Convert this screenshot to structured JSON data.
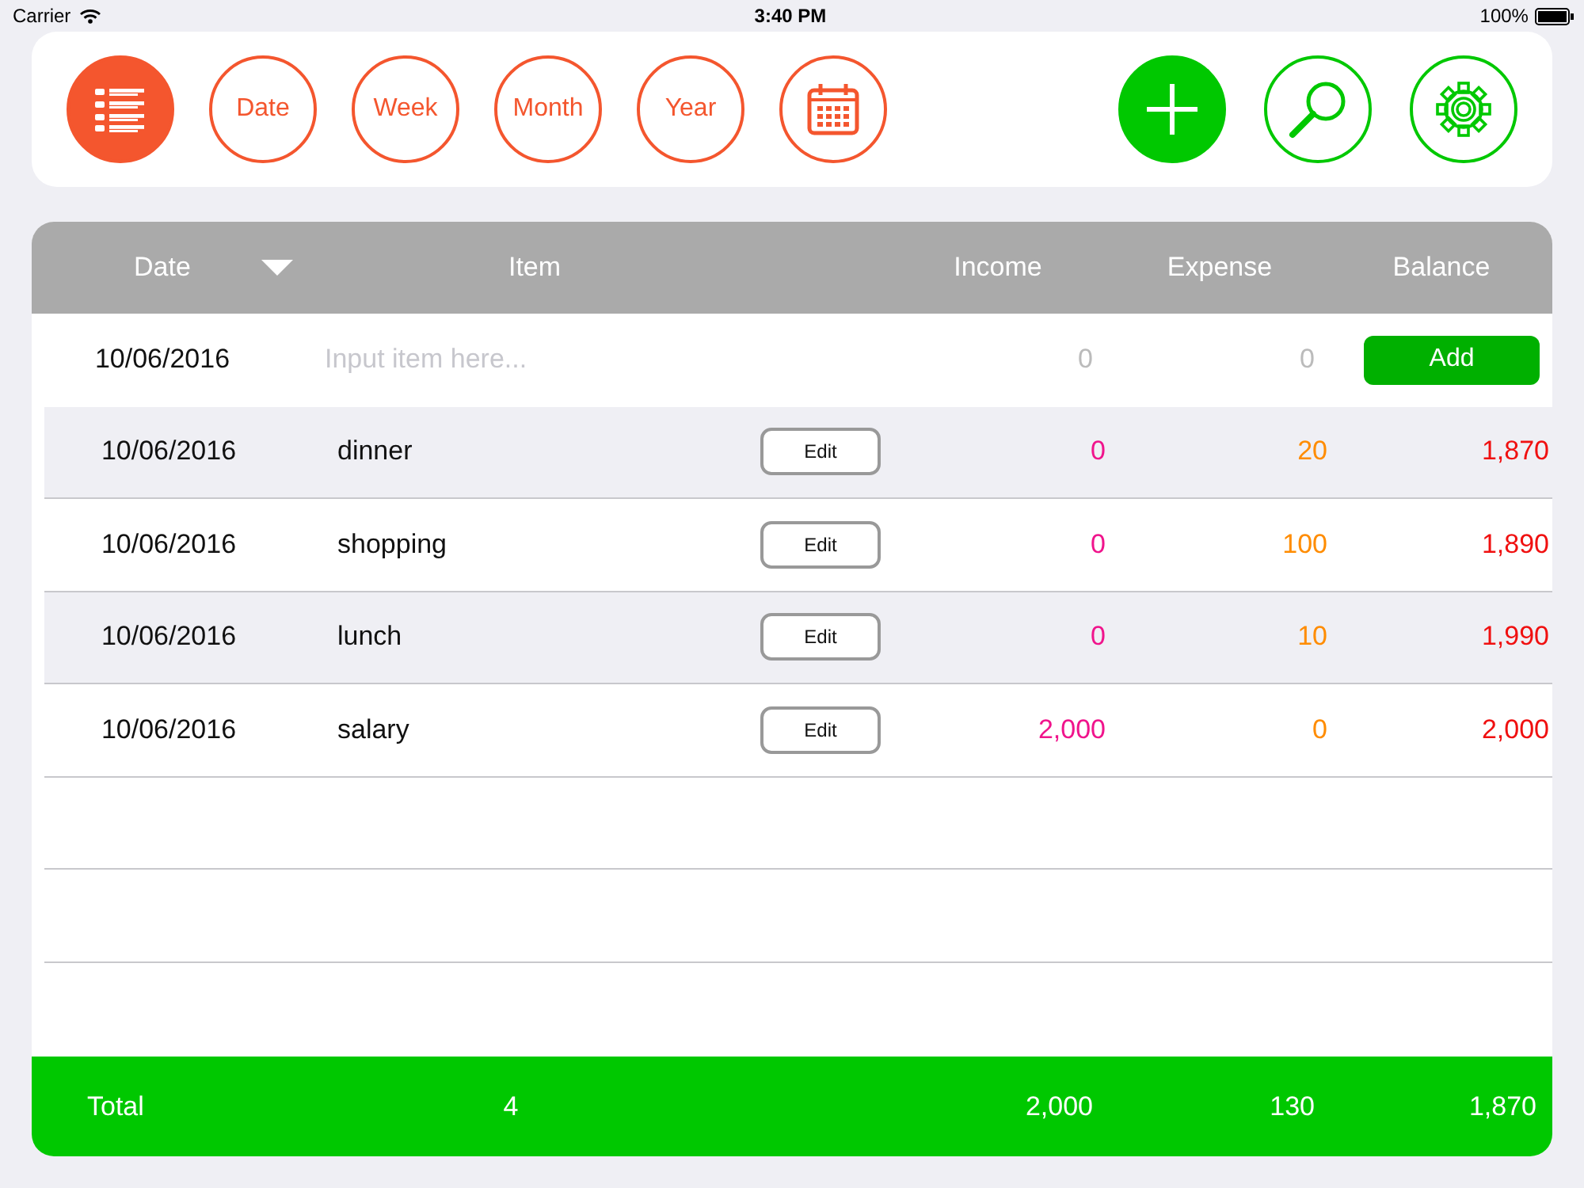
{
  "status_bar": {
    "carrier": "Carrier",
    "time": "3:40 PM",
    "battery": "100%"
  },
  "toolbar": {
    "filters": [
      {
        "kind": "list",
        "selected": true
      },
      {
        "kind": "text",
        "label": "Date",
        "selected": false
      },
      {
        "kind": "text",
        "label": "Week",
        "selected": false
      },
      {
        "kind": "text",
        "label": "Month",
        "selected": false
      },
      {
        "kind": "text",
        "label": "Year",
        "selected": false
      },
      {
        "kind": "calendar",
        "selected": false
      }
    ],
    "actions": [
      {
        "kind": "add"
      },
      {
        "kind": "search"
      },
      {
        "kind": "settings"
      }
    ]
  },
  "table": {
    "columns": [
      "Date",
      "Item",
      "Income",
      "Expense",
      "Balance"
    ],
    "new_entry": {
      "date": "10/06/2016",
      "placeholder": "Input item here...",
      "income": "0",
      "expense": "0",
      "button": "Add"
    },
    "rows": [
      {
        "date": "10/06/2016",
        "item": "dinner",
        "button": "Edit",
        "income": "0",
        "expense": "20",
        "balance": "1,870"
      },
      {
        "date": "10/06/2016",
        "item": "shopping",
        "button": "Edit",
        "income": "0",
        "expense": "100",
        "balance": "1,890"
      },
      {
        "date": "10/06/2016",
        "item": "lunch",
        "button": "Edit",
        "income": "0",
        "expense": "10",
        "balance": "1,990"
      },
      {
        "date": "10/06/2016",
        "item": "salary",
        "button": "Edit",
        "income": "2,000",
        "expense": "0",
        "balance": "2,000"
      }
    ],
    "total": {
      "label": "Total",
      "count": "4",
      "income": "2,000",
      "expense": "130",
      "balance": "1,870"
    }
  }
}
